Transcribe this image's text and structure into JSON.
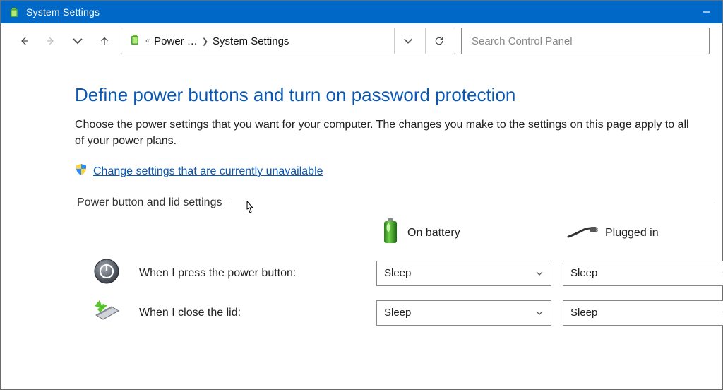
{
  "window": {
    "title": "System Settings"
  },
  "breadcrumb": {
    "item1": "Power …",
    "item2": "System Settings"
  },
  "search": {
    "placeholder": "Search Control Panel"
  },
  "page": {
    "heading": "Define power buttons and turn on password protection",
    "description": "Choose the power settings that you want for your computer. The changes you make to the settings on this page apply to all of your power plans.",
    "change_link": "Change settings that are currently unavailable",
    "section_label": "Power button and lid settings"
  },
  "columns": {
    "battery": "On battery",
    "plugged": "Plugged in"
  },
  "rows": {
    "power_button": {
      "label": "When I press the power button:",
      "battery_value": "Sleep",
      "plugged_value": "Sleep"
    },
    "lid": {
      "label": "When I close the lid:",
      "battery_value": "Sleep",
      "plugged_value": "Sleep"
    }
  }
}
